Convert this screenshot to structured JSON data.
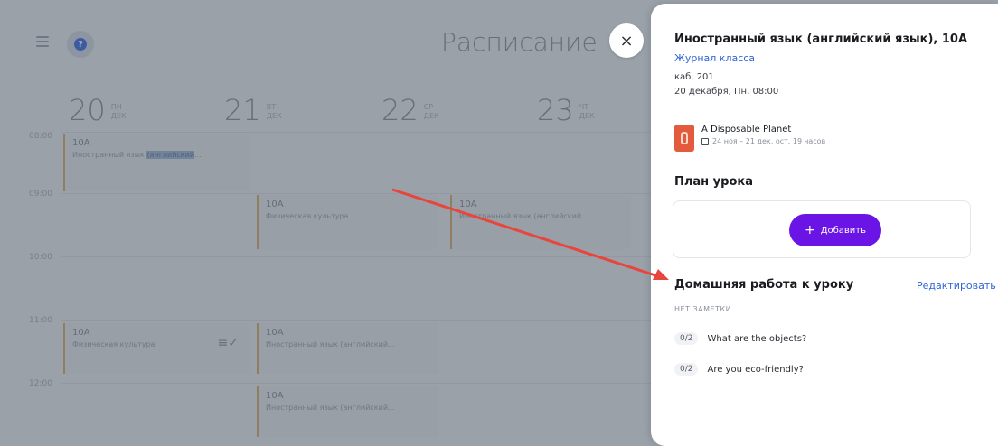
{
  "header": {
    "title": "Расписание",
    "close_label": "×",
    "help_label": "?"
  },
  "days": [
    {
      "num": "20",
      "weekday": "ПН",
      "month": "ДЕК"
    },
    {
      "num": "21",
      "weekday": "ВТ",
      "month": "ДЕК"
    },
    {
      "num": "22",
      "weekday": "СР",
      "month": "ДЕК"
    },
    {
      "num": "23",
      "weekday": "ЧТ",
      "month": "ДЕК"
    }
  ],
  "times": [
    "08:00",
    "09:00",
    "10:00",
    "11:00",
    "12:00"
  ],
  "lessons": [
    {
      "cls": "10A",
      "subject_prefix": "Иностранный язык ",
      "subject_highlight": "(английский",
      "subject_suffix": "..."
    },
    {
      "cls": "10A",
      "subject": "Физическая культура"
    },
    {
      "cls": "10A",
      "subject": "Иностранный язык (английский..."
    },
    {
      "cls": "10A",
      "subject": "Физическая культура"
    },
    {
      "cls": "10A",
      "subject": "Иностранный язык (английский..."
    },
    {
      "cls": "10A",
      "subject": "Иностранный язык (английский..."
    }
  ],
  "panel": {
    "title": "Иностранный язык (английский язык), 10А",
    "journal_link": "Журнал класса",
    "room": "каб. 201",
    "datetime": "20 декабря, Пн, 08:00",
    "book": {
      "name": "A Disposable Planet",
      "meta": "24 ноя – 21 дек, ост. 19 часов"
    },
    "plan_heading": "План урока",
    "add_label": "Добавить",
    "homework_heading": "Домашняя работа к уроку",
    "edit_label": "Редактировать",
    "no_notes": "НЕТ ЗАМЕТКИ",
    "tasks": [
      {
        "badge": "0/2",
        "text": "What are the objects?"
      },
      {
        "badge": "0/2",
        "text": "Are you eco-friendly?"
      }
    ]
  },
  "colors": {
    "accent": "#6a14e6",
    "link": "#2e63d8",
    "book": "#e45a3c",
    "arrow": "#e8453c"
  }
}
